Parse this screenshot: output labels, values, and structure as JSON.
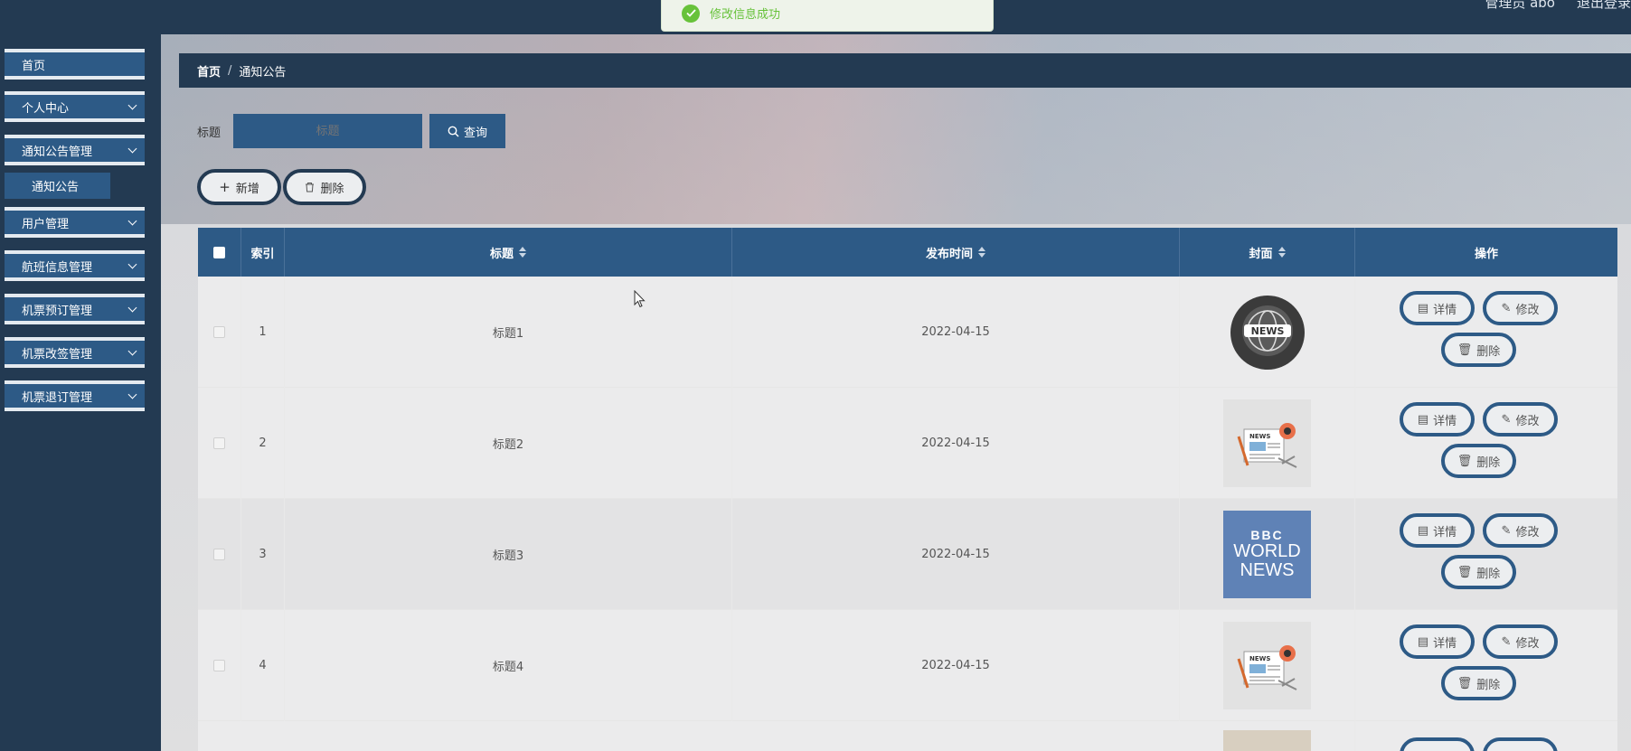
{
  "header": {
    "user_label": "管理员 abo",
    "logout_label": "退出登录"
  },
  "toast": {
    "message": "修改信息成功"
  },
  "sidebar": {
    "items": [
      {
        "label": "首页"
      },
      {
        "label": "个人中心"
      },
      {
        "label": "通知公告管理"
      },
      {
        "label": "用户管理"
      },
      {
        "label": "航班信息管理"
      },
      {
        "label": "机票预订管理"
      },
      {
        "label": "机票改签管理"
      },
      {
        "label": "机票退订管理"
      }
    ],
    "sub_item": {
      "label": "通知公告"
    }
  },
  "breadcrumb": {
    "home": "首页",
    "separator": "/",
    "current": "通知公告"
  },
  "search": {
    "label": "标题",
    "placeholder": "标题",
    "button": "查询"
  },
  "actions": {
    "add": "新增",
    "delete": "删除"
  },
  "table": {
    "headers": {
      "index": "索引",
      "title": "标题",
      "date": "发布时间",
      "cover": "封面",
      "ops": "操作"
    },
    "op_labels": {
      "detail": "详情",
      "edit": "修改",
      "delete": "删除"
    },
    "rows": [
      {
        "index": "1",
        "title": "标题1",
        "date": "2022-04-15",
        "cover": "news-globe"
      },
      {
        "index": "2",
        "title": "标题2",
        "date": "2022-04-15",
        "cover": "news-paper"
      },
      {
        "index": "3",
        "title": "标题3",
        "date": "2022-04-15",
        "cover": "bbc-world-news",
        "cover_text": [
          "BBC",
          "WORLD",
          "NEWS"
        ]
      },
      {
        "index": "4",
        "title": "标题4",
        "date": "2022-04-15",
        "cover": "news-paper"
      }
    ]
  },
  "colors": {
    "primary": "#2d5a86",
    "dark": "#233a52",
    "success": "#67c23a"
  }
}
